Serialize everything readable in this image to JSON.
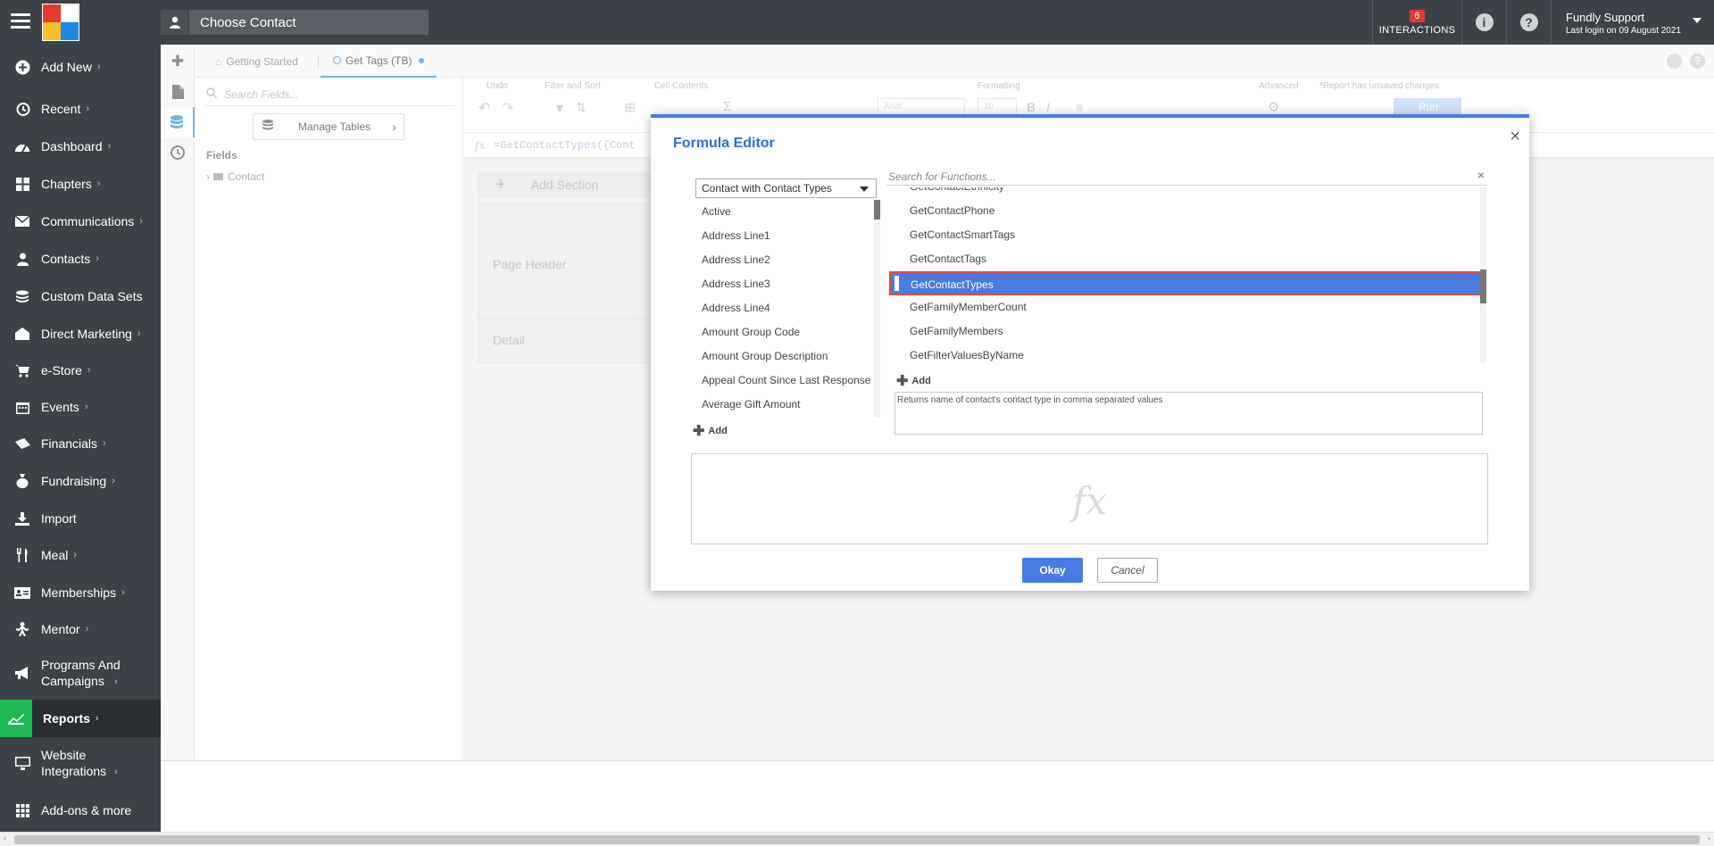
{
  "topbar": {
    "contact_label": "Choose Contact",
    "interactions_count": "6",
    "interactions_label": "INTERACTIONS",
    "user_name": "Fundly Support",
    "last_login": "Last login on 09 August 2021"
  },
  "nav": {
    "items": [
      {
        "label": "Add New",
        "icon": "plus-circle-icon"
      },
      {
        "label": "Recent",
        "icon": "history-icon"
      },
      {
        "label": "Dashboard",
        "icon": "dashboard-icon"
      },
      {
        "label": "Chapters",
        "icon": "grid-icon"
      },
      {
        "label": "Communications",
        "icon": "envelope-icon"
      },
      {
        "label": "Contacts",
        "icon": "person-icon"
      },
      {
        "label": "Custom Data Sets",
        "icon": "layers-icon"
      },
      {
        "label": "Direct Marketing",
        "icon": "megaphone-home-icon"
      },
      {
        "label": "e-Store",
        "icon": "cart-icon"
      },
      {
        "label": "Events",
        "icon": "calendar-icon"
      },
      {
        "label": "Financials",
        "icon": "ticket-icon"
      },
      {
        "label": "Fundraising",
        "icon": "moneybag-icon"
      },
      {
        "label": "Import",
        "icon": "import-icon"
      },
      {
        "label": "Meal",
        "icon": "utensils-icon"
      },
      {
        "label": "Memberships",
        "icon": "id-card-icon"
      },
      {
        "label": "Mentor",
        "icon": "mentor-icon"
      },
      {
        "label": "Programs And Campaigns",
        "icon": "bullhorn-icon"
      },
      {
        "label": "Reports",
        "icon": "chart-icon"
      },
      {
        "label": "Website Integrations",
        "icon": "monitor-icon"
      },
      {
        "label": "Add-ons & more",
        "icon": "apps-grid-icon"
      }
    ]
  },
  "tabs": [
    {
      "label": "Getting Started"
    },
    {
      "label": "Get Tags (TB)"
    }
  ],
  "fields_panel": {
    "search_placeholder": "Search Fields...",
    "manage_tables_label": "Manage Tables",
    "title": "Fields",
    "root_node": "Contact"
  },
  "ribbon": {
    "groups": [
      "Undo",
      "Filter and Sort",
      "Cell Contents",
      "Formatting",
      "Advanced",
      "*Report has unsaved changes"
    ],
    "font": "Arial",
    "font_size": "10",
    "run_label": "Run"
  },
  "formula_bar": {
    "text": "=GetContactTypes({Cont"
  },
  "designer": {
    "add_section": "Add Section",
    "page_header": "Page Header",
    "detail": "Detail"
  },
  "modal": {
    "title": "Formula Editor",
    "source_selected": "Contact with Contact Types",
    "fields": [
      "Active",
      "Address Line1",
      "Address Line2",
      "Address Line3",
      "Address Line4",
      "Amount Group Code",
      "Amount Group Description",
      "Appeal Count Since Last Response",
      "Average Gift Amount"
    ],
    "fields_add_label": "Add",
    "function_search_placeholder": "Search for Functions...",
    "functions": [
      "GetContactEthnicity",
      "GetContactPhone",
      "GetContactSmartTags",
      "GetContactTags",
      "GetContactTypes",
      "GetFamilyMemberCount",
      "GetFamilyMembers",
      "GetFilterValuesByName"
    ],
    "selected_function": "GetContactTypes",
    "functions_add_label": "Add",
    "description": "Returns name of contact's contact type in comma separated values",
    "okay_label": "Okay",
    "cancel_label": "Cancel"
  }
}
